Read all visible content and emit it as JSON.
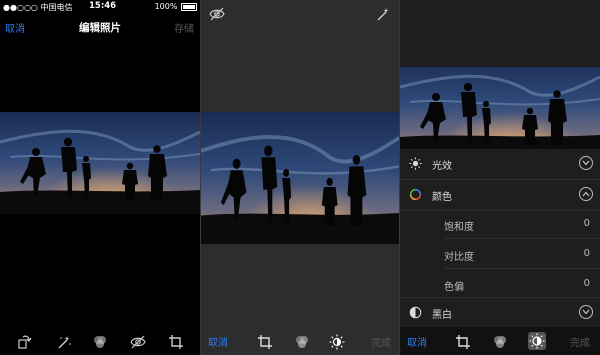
{
  "panel1": {
    "status": {
      "carrier": "●●○○○ 中国电信",
      "time": "15:46",
      "battery": "100%"
    },
    "nav": {
      "cancel": "取消",
      "title": "编辑照片",
      "save": "存储"
    }
  },
  "panel3": {
    "sections": [
      {
        "label": "光效",
        "icon": "sun-icon",
        "expanded": false
      },
      {
        "label": "颜色",
        "icon": "color-ring-icon",
        "expanded": true
      },
      {
        "label": "黑白",
        "icon": "half-circle-icon",
        "expanded": false
      }
    ],
    "color_params": [
      {
        "label": "饱和度",
        "value": "0"
      },
      {
        "label": "对比度",
        "value": "0"
      },
      {
        "label": "色偏",
        "value": "0"
      }
    ]
  },
  "toolbars": {
    "panel1": [
      "rotate-icon",
      "magic-wand-icon",
      "filters-icon",
      "hide-original-icon",
      "crop-icon"
    ],
    "panel2": {
      "cancel": "取消",
      "done": "完成",
      "icons": [
        "crop-icon",
        "filters-icon",
        "adjust-light-icon"
      ]
    },
    "panel3": {
      "cancel": "取消",
      "done": "完成",
      "icons": [
        "crop-icon",
        "filters-icon",
        "adjust-light-icon"
      ]
    }
  },
  "colors": {
    "accent": "#2b7cf2",
    "disabled": "#555555"
  }
}
